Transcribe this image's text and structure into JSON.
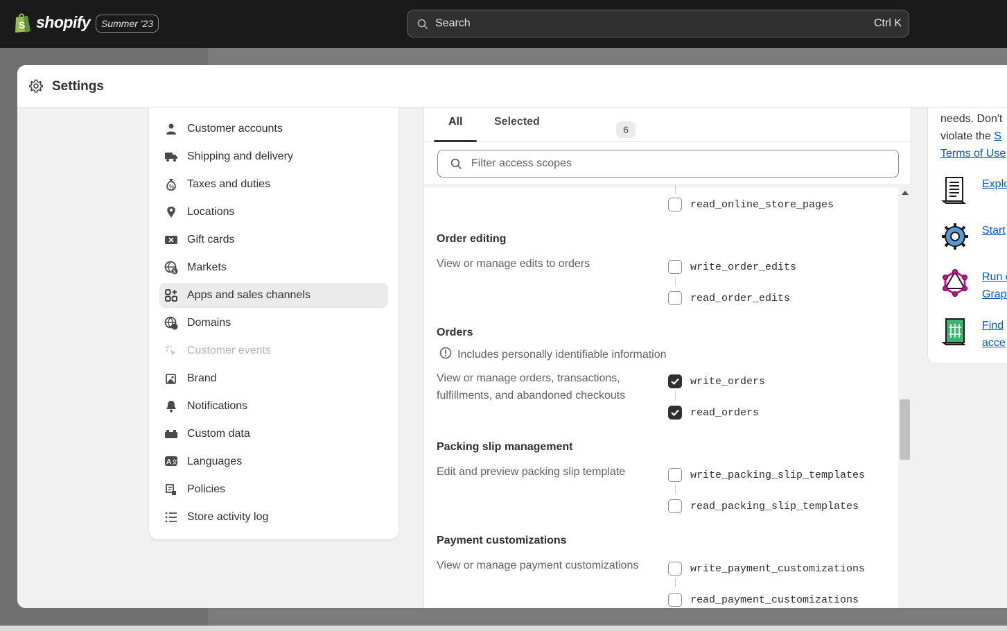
{
  "topbar": {
    "brand": "shopify",
    "edition_badge": "Summer '23",
    "search_placeholder": "Search",
    "search_shortcut": "Ctrl K"
  },
  "modal": {
    "title": "Settings"
  },
  "sidebar": {
    "items": [
      {
        "label": "Customer accounts",
        "icon": "person-icon"
      },
      {
        "label": "Shipping and delivery",
        "icon": "truck-icon"
      },
      {
        "label": "Taxes and duties",
        "icon": "money-bag-icon"
      },
      {
        "label": "Locations",
        "icon": "location-pin-icon"
      },
      {
        "label": "Gift cards",
        "icon": "gift-card-icon"
      },
      {
        "label": "Markets",
        "icon": "globe-dollar-icon"
      },
      {
        "label": "Apps and sales channels",
        "icon": "apps-icon",
        "active": true
      },
      {
        "label": "Domains",
        "icon": "globe-icon"
      },
      {
        "label": "Customer events",
        "icon": "cursor-click-icon",
        "disabled": true
      },
      {
        "label": "Brand",
        "icon": "image-icon"
      },
      {
        "label": "Notifications",
        "icon": "bell-icon"
      },
      {
        "label": "Custom data",
        "icon": "puzzle-block-icon"
      },
      {
        "label": "Languages",
        "icon": "translate-icon"
      },
      {
        "label": "Policies",
        "icon": "policy-icon"
      },
      {
        "label": "Store activity log",
        "icon": "list-icon"
      }
    ]
  },
  "scopes": {
    "tabs": {
      "all": "All",
      "selected": "Selected",
      "selected_count": "6"
    },
    "filter_placeholder": "Filter access scopes",
    "partial_scope": "read_online_store_pages",
    "sections": [
      {
        "title": "Order editing",
        "description": "View or manage edits to orders",
        "write": {
          "name": "write_order_edits",
          "checked": false
        },
        "read": {
          "name": "read_order_edits",
          "checked": false
        }
      },
      {
        "title": "Orders",
        "pii_note": "Includes personally identifiable information",
        "description": "View or manage orders, transactions, fulfillments, and abandoned checkouts",
        "write": {
          "name": "write_orders",
          "checked": true
        },
        "read": {
          "name": "read_orders",
          "checked": true
        }
      },
      {
        "title": "Packing slip management",
        "description": "Edit and preview packing slip template",
        "write": {
          "name": "write_packing_slip_templates",
          "checked": false
        },
        "read": {
          "name": "read_packing_slip_templates",
          "checked": false
        }
      },
      {
        "title": "Payment customizations",
        "description": "View or manage payment customizations",
        "write": {
          "name": "write_payment_customizations",
          "checked": false
        },
        "read": {
          "name": "read_payment_customizations",
          "checked": false
        }
      }
    ]
  },
  "info": {
    "line1": "needs. Don't",
    "line2_prefix": "violate the ",
    "line2_link": "S",
    "line3_link": "Terms of Use",
    "resources": [
      {
        "line1": "Explo",
        "line2": "",
        "icon": "scroll-icon"
      },
      {
        "line1": "Start",
        "line2": "",
        "icon": "gear-icon"
      },
      {
        "line1": "Run c",
        "line2": "Grap",
        "icon": "graphql-icon"
      },
      {
        "line1": "Find",
        "line2": "acce",
        "icon": "document-icon"
      }
    ]
  },
  "colors": {
    "topbar": "#1a1a1a",
    "link": "#005bd3",
    "checkbox_on": "#303030"
  }
}
